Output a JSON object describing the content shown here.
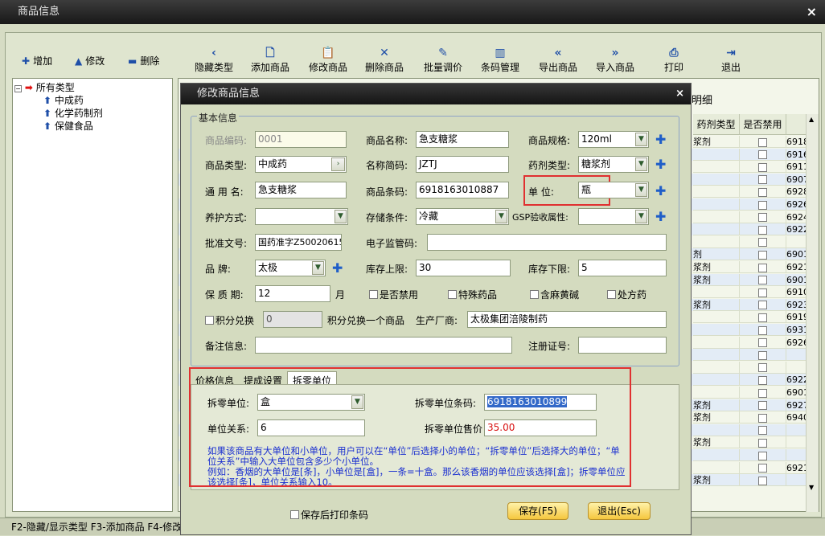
{
  "window": {
    "title": "商品信息"
  },
  "toolbar": {
    "small": [
      {
        "label": "增加",
        "icon": "plus-icon",
        "glyph": "✚"
      },
      {
        "label": "修改",
        "icon": "triangle-up-icon",
        "glyph": "▲"
      },
      {
        "label": "删除",
        "icon": "minus-icon",
        "glyph": "▬"
      }
    ],
    "buttons": [
      {
        "label": "隐藏类型",
        "icon": "chevron-left-icon",
        "glyph": "‹"
      },
      {
        "label": "添加商品",
        "icon": "document-icon",
        "glyph": "🗋"
      },
      {
        "label": "修改商品",
        "icon": "clipboard-icon",
        "glyph": "📋"
      },
      {
        "label": "删除商品",
        "icon": "x-icon",
        "glyph": "✕"
      },
      {
        "label": "批量调价",
        "icon": "pen-icon",
        "glyph": "✎"
      },
      {
        "label": "条码管理",
        "icon": "barcode-icon",
        "glyph": "▥"
      },
      {
        "label": "导出商品",
        "icon": "double-left-icon",
        "glyph": "«"
      },
      {
        "label": "导入商品",
        "icon": "double-right-icon",
        "glyph": "»"
      },
      {
        "label": "打印",
        "icon": "printer-icon",
        "glyph": "⎙"
      },
      {
        "label": "退出",
        "icon": "exit-icon",
        "glyph": "⇥"
      }
    ]
  },
  "tree": {
    "root": "所有类型",
    "children": [
      "中成药",
      "化学药制剂",
      "保健食品"
    ]
  },
  "grid": {
    "partial_header": "明细",
    "columns": [
      "药剂类型",
      "是否禁用"
    ],
    "rows": [
      {
        "type": "浆剂",
        "code": "6918"
      },
      {
        "type": "",
        "code": "6916"
      },
      {
        "type": "",
        "code": "6911"
      },
      {
        "type": "",
        "code": "6907"
      },
      {
        "type": "",
        "code": "6928"
      },
      {
        "type": "",
        "code": "6926"
      },
      {
        "type": "",
        "code": "6924"
      },
      {
        "type": "",
        "code": "6922"
      },
      {
        "type": "",
        "code": ""
      },
      {
        "type": "剂",
        "code": "6901"
      },
      {
        "type": "浆剂",
        "code": "6921"
      },
      {
        "type": "浆剂",
        "code": "6901"
      },
      {
        "type": "",
        "code": "6910"
      },
      {
        "type": "浆剂",
        "code": "6923"
      },
      {
        "type": "",
        "code": "6919"
      },
      {
        "type": "",
        "code": "6931"
      },
      {
        "type": "",
        "code": "6926"
      },
      {
        "type": "",
        "code": ""
      },
      {
        "type": "",
        "code": ""
      },
      {
        "type": "",
        "code": "6922"
      },
      {
        "type": "",
        "code": "6901"
      },
      {
        "type": "浆剂",
        "code": "6927"
      },
      {
        "type": "浆剂",
        "code": "6940"
      },
      {
        "type": "",
        "code": ""
      },
      {
        "type": "浆剂",
        "code": ""
      },
      {
        "type": "",
        "code": ""
      },
      {
        "type": "",
        "code": "6921"
      },
      {
        "type": "浆剂",
        "code": ""
      }
    ]
  },
  "statusbar": {
    "text": "F2-隐藏/显示类型  F3-添加商品  F4-修改"
  },
  "dialog": {
    "title": "修改商品信息",
    "group_title": "基本信息",
    "fields": {
      "code_label": "商品编码:",
      "code": "0001",
      "name_label": "商品名称:",
      "name": "急支糖浆",
      "spec_label": "商品规格:",
      "spec": "120ml",
      "type_label": "商品类型:",
      "type": "中成药",
      "short_label": "名称简码:",
      "short": "JZTJ",
      "dosage_label": "药剂类型:",
      "dosage": "糖浆剂",
      "common_label": "通 用 名:",
      "common": "急支糖浆",
      "barcode_label": "商品条码:",
      "barcode": "6918163010887",
      "unit_label": "单    位:",
      "unit": "瓶",
      "care_label": "养护方式:",
      "care": "",
      "storage_label": "存储条件:",
      "storage": "冷藏",
      "gsp_label": "GSP验收属性:",
      "gsp": "",
      "approval_label": "批准文号:",
      "approval": "国药准字Z50020615",
      "esup_label": "电子监管码:",
      "esup": "",
      "brand_label": "品    牌:",
      "brand": "太极",
      "max_label": "库存上限:",
      "max": "30",
      "min_label": "库存下限:",
      "min": "5",
      "shelf_label": "保 质 期:",
      "shelf": "12",
      "shelf_unit": "月",
      "points_input": "0",
      "points_text": "积分兑换一个商品",
      "maker_label": "生产厂商:",
      "maker": "太极集团涪陵制药",
      "remark_label": "备注信息:",
      "remark": "",
      "reg_label": "注册证号:",
      "reg": ""
    },
    "checks": {
      "disabled": "是否禁用",
      "special": "特殊药品",
      "ephedrine": "含麻黄碱",
      "rx": "处方药",
      "points": "积分兑换"
    },
    "tabs": [
      "价格信息",
      "提成设置",
      "拆零单位"
    ],
    "split": {
      "unit_label": "拆零单位:",
      "unit": "盒",
      "barcode_label": "拆零单位条码:",
      "barcode": "6918163010899",
      "relation_label": "单位关系:",
      "relation": "6",
      "price_label": "拆零单位售价",
      "price": "35.00",
      "hint1": "如果该商品有大单位和小单位，用户可以在“单位”后选择小的单位；“拆零单位”后选择大的单位；“单位关系”中输入大单位包含多少个小单位。",
      "hint2": "例如：香烟的大单位是[条]，小单位是[盒]，一条=十盒。那么该香烟的单位应该选择[盒]；拆零单位应该选择[条]，单位关系输入10。"
    },
    "footer": {
      "print_label": "保存后打印条码",
      "save": "保存(F5)",
      "exit": "退出(Esc)"
    }
  }
}
